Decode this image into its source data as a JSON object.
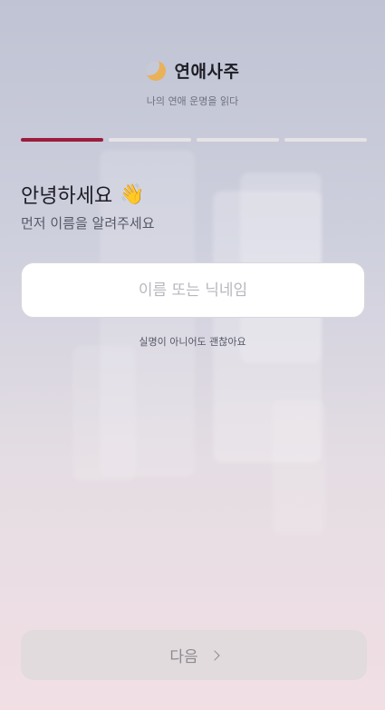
{
  "header": {
    "icon": "crescent-moon-icon",
    "title": "연애사주",
    "subtitle": "나의 연애 운명을 읽다"
  },
  "progress": {
    "current_step": 1,
    "total_steps": 4,
    "active_color": "#9b1c3d"
  },
  "main": {
    "greeting": "안녕하세요",
    "greeting_emoji": "👋",
    "prompt": "먼저 이름을 알려주세요",
    "name_input": {
      "value": "",
      "placeholder": "이름 또는 닉네임"
    },
    "hint": "실명이 아니어도 괜찮아요"
  },
  "footer": {
    "next_label": "다음",
    "next_icon": "chevron-right-icon"
  }
}
